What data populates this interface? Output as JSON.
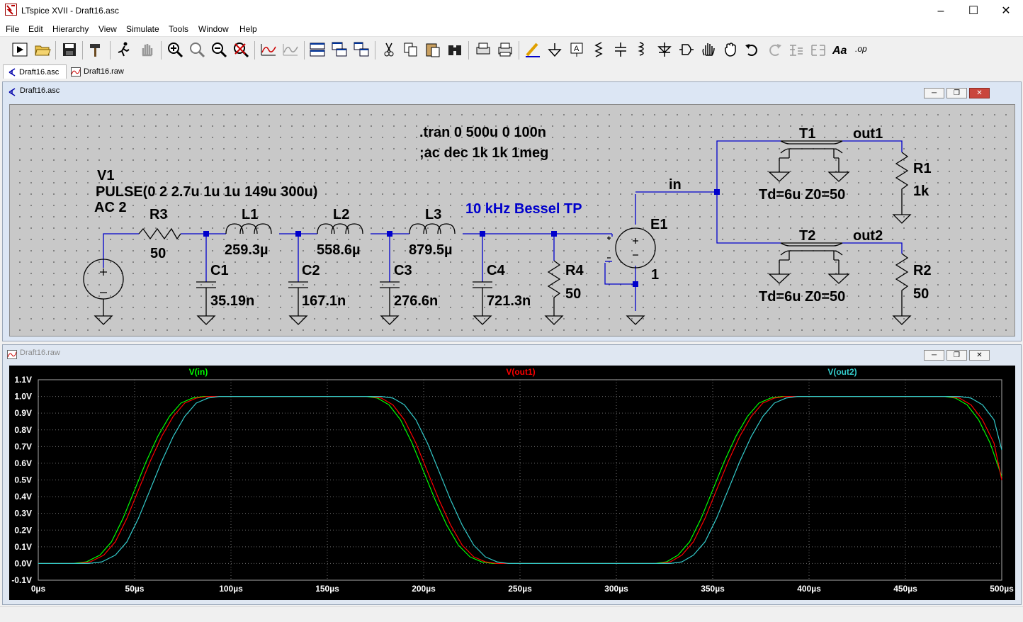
{
  "window": {
    "title": "LTspice XVII - Draft16.asc"
  },
  "menu": [
    "File",
    "Edit",
    "Hierarchy",
    "View",
    "Simulate",
    "Tools",
    "Window",
    "Help"
  ],
  "tabs": [
    {
      "label": "Draft16.asc"
    },
    {
      "label": "Draft16.raw"
    }
  ],
  "schematic_window": {
    "title": "Draft16.asc"
  },
  "plot_window": {
    "title": "Draft16.raw"
  },
  "schematic": {
    "directives": [
      ".tran 0 500u 0 100n",
      ";ac dec 1k 1k 1meg"
    ],
    "comment": "10 kHz Bessel TP",
    "source": {
      "name": "V1",
      "value": "PULSE(0 2 2.7u 1u 1u 149u 300u)",
      "ac": "AC 2"
    },
    "R3": {
      "name": "R3",
      "value": "50"
    },
    "L1": {
      "name": "L1",
      "value": "259.3µ"
    },
    "L2": {
      "name": "L2",
      "value": "558.6µ"
    },
    "L3": {
      "name": "L3",
      "value": "879.5µ"
    },
    "C1": {
      "name": "C1",
      "value": "35.19n"
    },
    "C2": {
      "name": "C2",
      "value": "167.1n"
    },
    "C3": {
      "name": "C3",
      "value": "276.6n"
    },
    "C4": {
      "name": "C4",
      "value": "721.3n"
    },
    "R4": {
      "name": "R4",
      "value": "50"
    },
    "E1": {
      "name": "E1",
      "value": "1"
    },
    "net_in": "in",
    "T1": {
      "name": "T1",
      "value": "Td=6u Z0=50",
      "net": "out1"
    },
    "T2": {
      "name": "T2",
      "value": "Td=6u Z0=50",
      "net": "out2"
    },
    "R1": {
      "name": "R1",
      "value": "1k"
    },
    "R2": {
      "name": "R2",
      "value": "50"
    }
  },
  "chart_data": {
    "type": "line",
    "x_unit": "µs",
    "xlim": [
      0,
      500
    ],
    "ylim": [
      -0.1,
      1.1
    ],
    "x_ticks": [
      "0µs",
      "50µs",
      "100µs",
      "150µs",
      "200µs",
      "250µs",
      "300µs",
      "350µs",
      "400µs",
      "450µs",
      "500µs"
    ],
    "y_ticks": [
      "-0.1V",
      "0.0V",
      "0.1V",
      "0.2V",
      "0.3V",
      "0.4V",
      "0.5V",
      "0.6V",
      "0.7V",
      "0.8V",
      "0.9V",
      "1.0V",
      "1.1V"
    ],
    "series": [
      {
        "name": "V(in)",
        "color": "#00ff00",
        "x": [
          0,
          18,
          25,
          32,
          38,
          44,
          50,
          56,
          62,
          68,
          74,
          80,
          86,
          92,
          170,
          176,
          182,
          188,
          194,
          200,
          206,
          212,
          218,
          224,
          230,
          236,
          242,
          320,
          326,
          332,
          338,
          344,
          350,
          356,
          362,
          368,
          374,
          380,
          386,
          392,
          470,
          476,
          482,
          488,
          494,
          500
        ],
        "y": [
          0,
          0,
          0.01,
          0.05,
          0.13,
          0.27,
          0.44,
          0.61,
          0.76,
          0.88,
          0.96,
          0.99,
          1.0,
          1.0,
          1.0,
          0.99,
          0.95,
          0.86,
          0.72,
          0.55,
          0.38,
          0.23,
          0.11,
          0.04,
          0.01,
          0,
          0,
          0,
          0.01,
          0.05,
          0.13,
          0.27,
          0.44,
          0.61,
          0.76,
          0.88,
          0.96,
          0.99,
          1.0,
          1.0,
          1.0,
          0.99,
          0.95,
          0.86,
          0.72,
          0.52
        ]
      },
      {
        "name": "V(out1)",
        "color": "#ff0000",
        "x": [
          0,
          20,
          27,
          34,
          40,
          46,
          52,
          58,
          64,
          70,
          76,
          82,
          88,
          94,
          172,
          178,
          184,
          190,
          196,
          202,
          208,
          214,
          220,
          226,
          232,
          238,
          244,
          322,
          328,
          334,
          340,
          346,
          352,
          358,
          364,
          370,
          376,
          382,
          388,
          394,
          472,
          478,
          484,
          490,
          496,
          500
        ],
        "y": [
          0,
          0,
          0.01,
          0.05,
          0.13,
          0.27,
          0.44,
          0.61,
          0.76,
          0.88,
          0.96,
          0.99,
          1.0,
          1.0,
          1.0,
          0.99,
          0.95,
          0.86,
          0.72,
          0.55,
          0.38,
          0.23,
          0.11,
          0.04,
          0.01,
          0,
          0,
          0,
          0.01,
          0.05,
          0.13,
          0.27,
          0.44,
          0.61,
          0.76,
          0.88,
          0.96,
          0.99,
          1.0,
          1.0,
          1.0,
          0.99,
          0.95,
          0.86,
          0.72,
          0.5
        ]
      },
      {
        "name": "V(out2)",
        "color": "#33cccc",
        "x": [
          0,
          26,
          33,
          40,
          46,
          52,
          58,
          64,
          70,
          76,
          82,
          88,
          94,
          100,
          178,
          184,
          190,
          196,
          202,
          208,
          214,
          220,
          226,
          232,
          238,
          244,
          250,
          328,
          334,
          340,
          346,
          352,
          358,
          364,
          370,
          376,
          382,
          388,
          394,
          400,
          478,
          484,
          490,
          496,
          500
        ],
        "y": [
          0,
          0,
          0.01,
          0.05,
          0.13,
          0.27,
          0.44,
          0.61,
          0.76,
          0.88,
          0.96,
          0.99,
          1.0,
          1.0,
          1.0,
          0.99,
          0.95,
          0.86,
          0.72,
          0.55,
          0.38,
          0.23,
          0.11,
          0.04,
          0.01,
          0,
          0,
          0,
          0.01,
          0.05,
          0.13,
          0.27,
          0.44,
          0.61,
          0.76,
          0.88,
          0.96,
          0.99,
          1.0,
          1.0,
          1.0,
          0.99,
          0.95,
          0.86,
          0.68
        ]
      }
    ]
  },
  "colors": {
    "wire": "#0000cc",
    "plot_bg": "#000000",
    "grid": "#6e6e6e",
    "comment": "#0000cc"
  }
}
